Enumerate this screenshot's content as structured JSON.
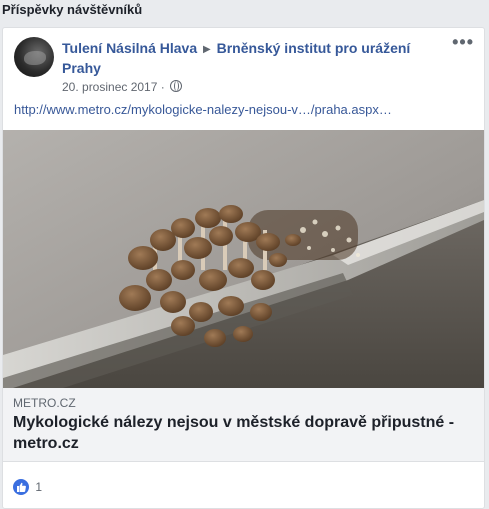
{
  "section": {
    "title": "Příspěvky návštěvníků"
  },
  "post": {
    "author": "Tulení Násilná Hlava",
    "target": "Brněnský institut pro urážení Prahy",
    "date": "20. prosinec 2017",
    "privacy_icon": "globe-icon",
    "more_label": "•••",
    "link_text": "http://www.metro.cz/mykologicke-nalezy-nejsou-v…/praha.aspx…",
    "preview": {
      "domain": "METRO.CZ",
      "title": "Mykologické nálezy nejsou v městské dopravě připustné - metro.cz"
    },
    "reactions": {
      "icon": "like-icon",
      "count": "1"
    }
  },
  "colors": {
    "link_blue": "#365899",
    "like_blue": "#3b6fe0",
    "page_bg": "#e9ebee"
  }
}
